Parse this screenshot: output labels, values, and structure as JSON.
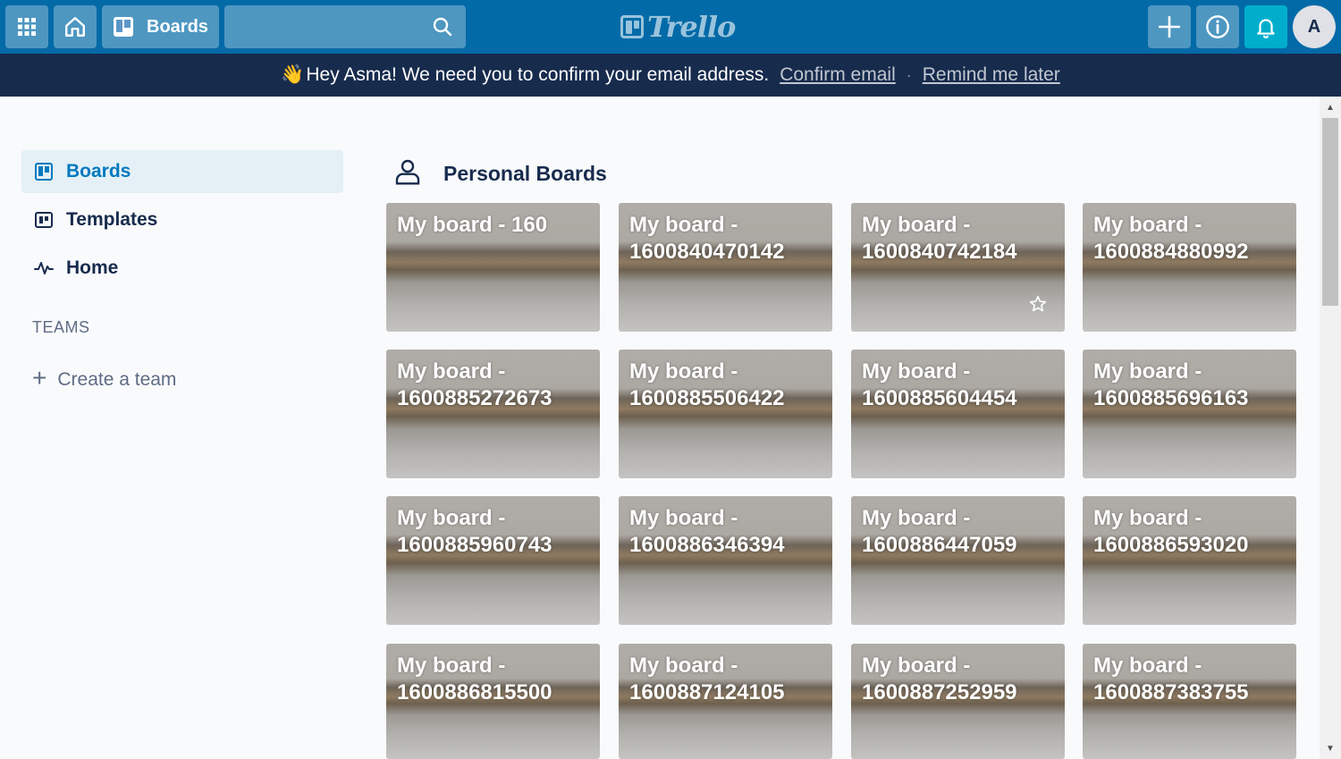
{
  "header": {
    "apps_icon": "grid-icon",
    "home_icon": "house-icon",
    "boards_label": "Boards",
    "search": {
      "value": "",
      "placeholder": ""
    },
    "logo_text": "Trello",
    "create_icon": "plus-icon",
    "info_icon": "info-icon",
    "notifications_icon": "bell-icon",
    "avatar_initial": "A"
  },
  "banner": {
    "emoji": "👋",
    "message": "Hey Asma! We need you to confirm your email address.",
    "confirm_link": "Confirm email",
    "separator": "·",
    "remind_link": "Remind me later"
  },
  "sidebar": {
    "items": [
      {
        "label": "Boards",
        "icon": "board-icon",
        "active": true
      },
      {
        "label": "Templates",
        "icon": "templates-icon",
        "active": false
      },
      {
        "label": "Home",
        "icon": "activity-icon",
        "active": false
      }
    ],
    "teams_label": "TEAMS",
    "create_team_label": "Create a team"
  },
  "main": {
    "section_title": "Personal Boards",
    "section_icon": "person-icon",
    "boards": [
      {
        "title": "My board - 160"
      },
      {
        "title": "My board - 1600840470142"
      },
      {
        "title": "My board - 1600840742184"
      },
      {
        "title": "My board - 1600884880992"
      },
      {
        "title": "My board - 1600885272673"
      },
      {
        "title": "My board - 1600885506422"
      },
      {
        "title": "My board - 1600885604454"
      },
      {
        "title": "My board - 1600885696163"
      },
      {
        "title": "My board - 1600885960743"
      },
      {
        "title": "My board - 1600886346394"
      },
      {
        "title": "My board - 1600886447059"
      },
      {
        "title": "My board - 1600886593020"
      },
      {
        "title": "My board - 1600886815500"
      },
      {
        "title": "My board - 1600887124105"
      },
      {
        "title": "My board - 1600887252959"
      },
      {
        "title": "My board - 1600887383755"
      }
    ]
  },
  "colors": {
    "header": "#026aa7",
    "banner": "#172b4d",
    "notification_button": "#00aecc",
    "active_sidebar_bg": "#e4f0f6",
    "active_sidebar_text": "#0079bf"
  }
}
